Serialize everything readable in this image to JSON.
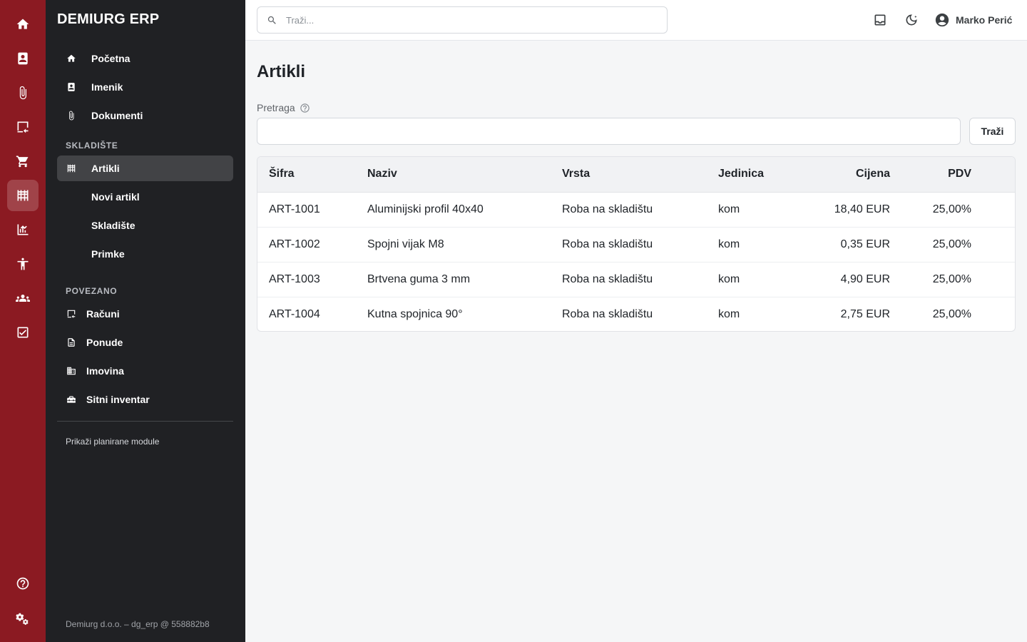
{
  "app": {
    "brand": "DEMIURG ERP"
  },
  "rail": {
    "items": [
      {
        "icon": "home-icon"
      },
      {
        "icon": "contacts-book-icon"
      },
      {
        "icon": "paperclip-icon"
      },
      {
        "icon": "invoice-icon"
      },
      {
        "icon": "cart-icon"
      },
      {
        "icon": "warehouse-icon",
        "active": true
      },
      {
        "icon": "chart-icon"
      },
      {
        "icon": "accessibility-icon"
      },
      {
        "icon": "people-icon"
      },
      {
        "icon": "checkbox-icon"
      },
      {
        "icon": "help-icon"
      },
      {
        "icon": "settings-icon"
      }
    ]
  },
  "sidebar": {
    "top_items": [
      {
        "label": "Početna",
        "icon": "home-icon"
      },
      {
        "label": "Imenik",
        "icon": "contacts-book-icon"
      },
      {
        "label": "Dokumenti",
        "icon": "paperclip-icon"
      }
    ],
    "section_warehouse": "SKLADIŠTE",
    "warehouse_items": [
      {
        "label": "Artikli",
        "icon": "warehouse-icon",
        "active": true
      },
      {
        "label": "Novi artikl"
      },
      {
        "label": "Skladište"
      },
      {
        "label": "Primke"
      }
    ],
    "section_related": "POVEZANO",
    "related_items": [
      {
        "label": "Računi",
        "icon": "invoice-icon"
      },
      {
        "label": "Ponude",
        "icon": "document-icon"
      },
      {
        "label": "Imovina",
        "icon": "building-icon"
      },
      {
        "label": "Sitni inventar",
        "icon": "toolbox-icon"
      }
    ],
    "planned_link": "Prikaži planirane module",
    "footer": "Demiurg d.o.o. – dg_erp @ 558882b8"
  },
  "topbar": {
    "search_placeholder": "Traži...",
    "user_name": "Marko Perić"
  },
  "main": {
    "title": "Artikli",
    "filter_label": "Pretraga",
    "filter_value": "",
    "search_button": "Traži",
    "table": {
      "columns": [
        "Šifra",
        "Naziv",
        "Vrsta",
        "Jedinica",
        "Cijena",
        "PDV"
      ],
      "rows": [
        [
          "ART-1001",
          "Aluminijski profil 40x40",
          "Roba na skladištu",
          "kom",
          "18,40 EUR",
          "25,00%"
        ],
        [
          "ART-1002",
          "Spojni vijak M8",
          "Roba na skladištu",
          "kom",
          "0,35 EUR",
          "25,00%"
        ],
        [
          "ART-1003",
          "Brtvena guma 3 mm",
          "Roba na skladištu",
          "kom",
          "4,90 EUR",
          "25,00%"
        ],
        [
          "ART-1004",
          "Kutna spojnica 90°",
          "Roba na skladištu",
          "kom",
          "2,75 EUR",
          "25,00%"
        ]
      ]
    }
  },
  "colors": {
    "rail": "#8b1a22",
    "sidebar": "#202124",
    "sidebar_active": "#424346",
    "page_bg": "#f5f6f7"
  }
}
